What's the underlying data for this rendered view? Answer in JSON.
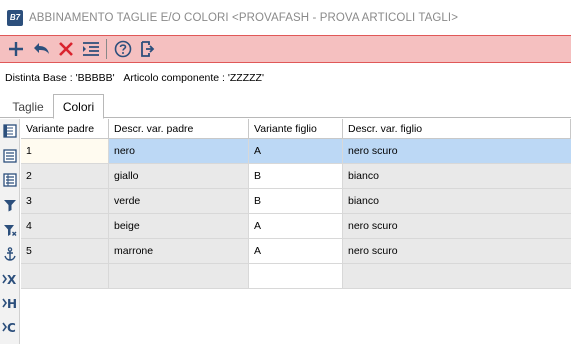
{
  "window": {
    "app_icon_text": "B7",
    "title": "ABBINAMENTO TAGLIE E/O COLORI <PROVAFASH - PROVA ARTICOLI TAGLI>"
  },
  "toolbar": {
    "buttons": [
      "add-icon",
      "undo-icon",
      "delete-icon",
      "list-settings-icon",
      "help-icon",
      "exit-icon"
    ]
  },
  "info": {
    "distinta_label": "Distinta Base : 'BBBBB'",
    "articolo_label": "Articolo componente : 'ZZZZZ'"
  },
  "tabs": [
    {
      "label": "Taglie",
      "active": false
    },
    {
      "label": "Colori",
      "active": true
    }
  ],
  "side_buttons": [
    "document-icon",
    "list-icon",
    "list-alt-icon",
    "filter-icon",
    "filter-clear-icon",
    "anchor-icon",
    "arrow-x-icon",
    "arrow-h-icon",
    "arrow-c-icon"
  ],
  "side_letters": {
    "x": "X",
    "h": "H",
    "c": "C"
  },
  "table": {
    "columns": [
      "Variante padre",
      "Descr. var. padre",
      "Variante figlio",
      "Descr. var. figlio"
    ],
    "rows": [
      [
        "1",
        "nero",
        "A",
        "nero scuro"
      ],
      [
        "2",
        "giallo",
        "B",
        "bianco"
      ],
      [
        "3",
        "verde",
        "B",
        "bianco"
      ],
      [
        "4",
        "beige",
        "A",
        "nero scuro"
      ],
      [
        "5",
        "marrone",
        "A",
        "nero scuro"
      ]
    ],
    "selected_row": 0
  },
  "colors": {
    "toolbar_bg": "#f5c0c0",
    "toolbar_border": "#e05858",
    "selection": "#bcd8f5",
    "icon_blue": "#2c4f7c",
    "icon_red": "#d9232d"
  }
}
